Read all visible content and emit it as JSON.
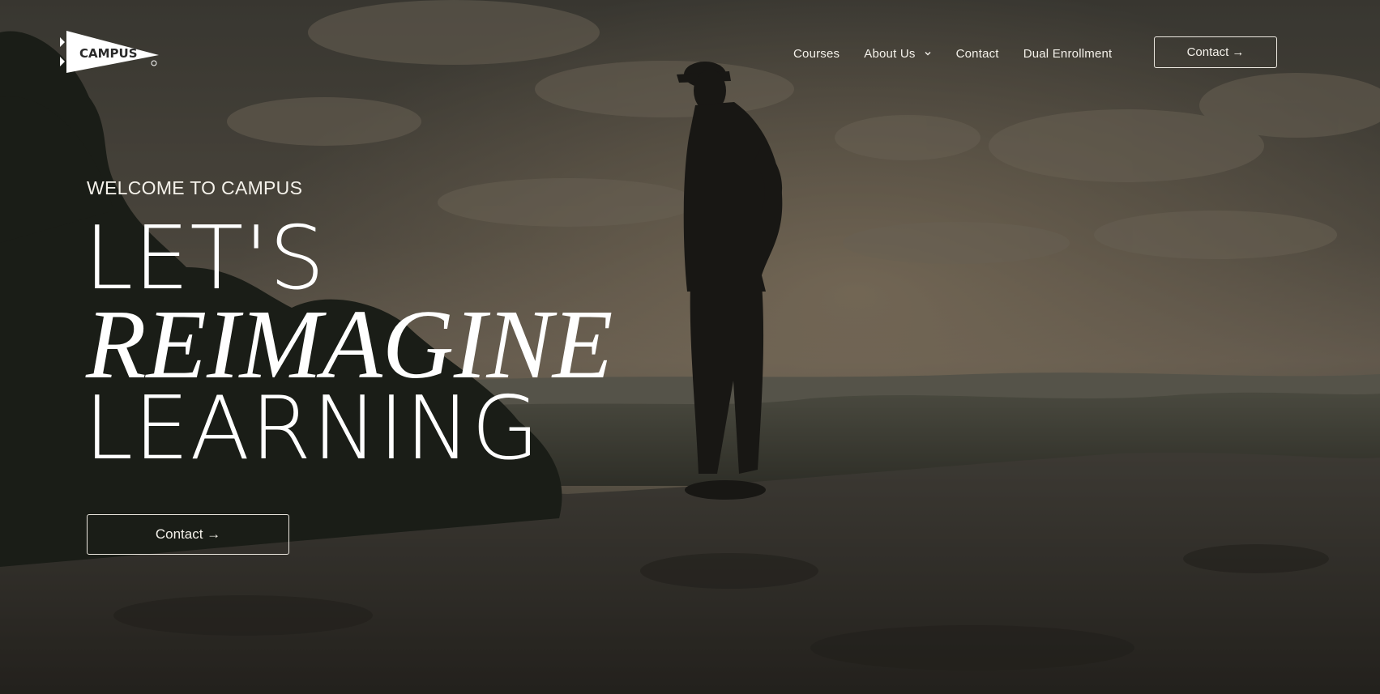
{
  "brand": {
    "logo_text": "CAMPUS",
    "registered_mark": "®"
  },
  "nav": {
    "items": [
      {
        "label": "Courses",
        "has_dropdown": false
      },
      {
        "label": "About Us",
        "has_dropdown": true
      },
      {
        "label": "Contact",
        "has_dropdown": false
      },
      {
        "label": "Dual Enrollment",
        "has_dropdown": false
      }
    ],
    "cta_label": "Contact →"
  },
  "hero": {
    "eyebrow": "WELCOME TO CAMPUS",
    "headline_line1": "LET'S",
    "headline_line2": "REIMAGINE",
    "headline_line3": "LEARNING",
    "cta_label": "Contact →"
  },
  "icons": {
    "logo": "pennant-logo-icon",
    "dropdown": "chevron-down-icon"
  },
  "colors": {
    "text": "#f4f1ea",
    "overlay": "#141210"
  }
}
